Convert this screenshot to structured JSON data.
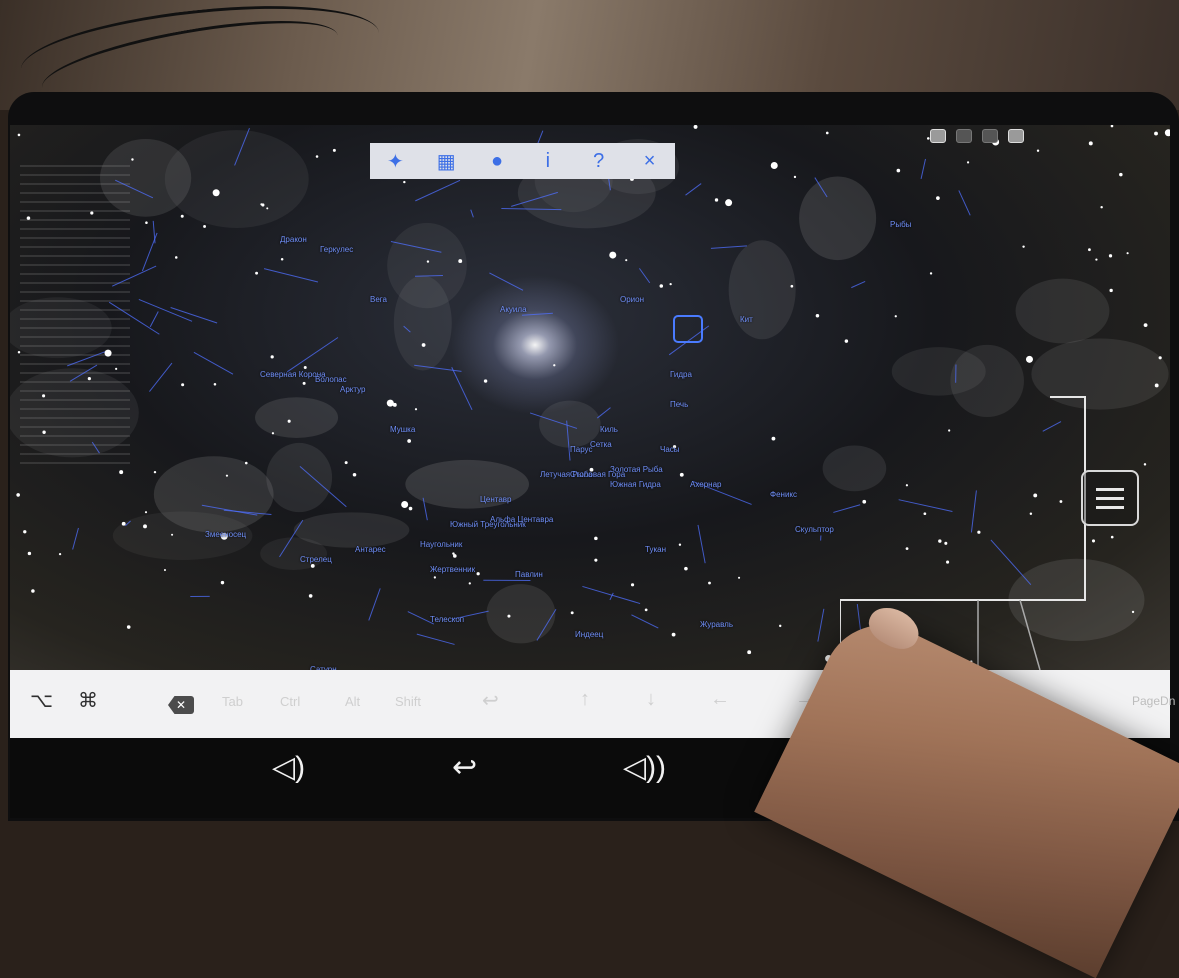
{
  "top_toolbar": {
    "icons": [
      "pin-icon",
      "keyboard-icon",
      "lock-icon",
      "info-icon",
      "help-icon",
      "close-icon"
    ],
    "info_label": "i",
    "help_label": "?",
    "close_label": "×"
  },
  "constellations": [
    "Дракон",
    "Геркулес",
    "Северная Корона",
    "Волопас",
    "Змееносец",
    "Стрелец",
    "Наугольник",
    "Жертвенник",
    "Павлин",
    "Телескоп",
    "Индеец",
    "Журавль",
    "Тукан",
    "Скульптор",
    "Феникс",
    "Гидра",
    "Центавр",
    "Южный Треугольник",
    "Мушка",
    "Летучая Рыба",
    "Киль",
    "Парус",
    "Орион",
    "Кит",
    "Рыбы",
    "Антарес",
    "Сатурн",
    "Южная Гидра",
    "Часы",
    "Сетка",
    "Золотая Рыба",
    "Столовая Гора",
    "Печь",
    "Ахернар",
    "Арктур",
    "Вега",
    "Акуила",
    "Альфа Центавра"
  ],
  "keyboard_bar": {
    "keys": [
      "⌥",
      "⌘",
      "⌫",
      "Tab",
      "Ctrl",
      "Alt",
      "Shift",
      "↩",
      "↑",
      "↓",
      "←",
      "→"
    ],
    "page_label": "PageDn"
  },
  "nav_bar": {
    "icons": [
      "volume-down-icon",
      "back-icon",
      "volume-up-icon"
    ],
    "vol_down": "◁)",
    "back": "↩",
    "vol_up": "◁))"
  },
  "colors": {
    "constellation_lines": "#4f6fff",
    "label_text": "#6f8ef7",
    "toolbar_icons": "#3d6fe6"
  }
}
